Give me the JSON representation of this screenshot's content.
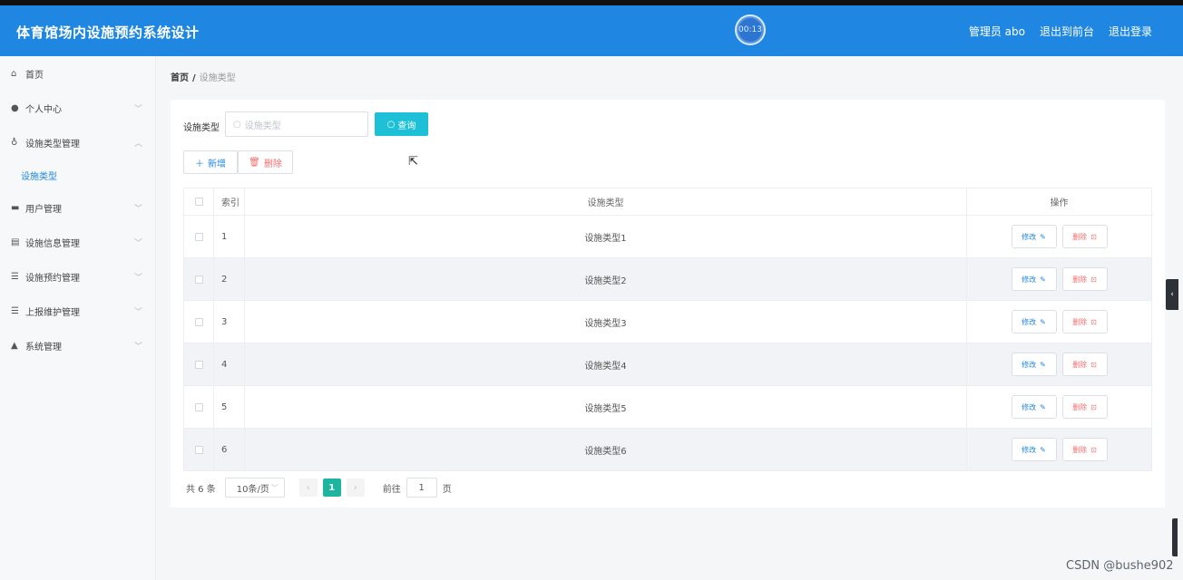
{
  "header": {
    "title": "体育馆场内设施预约系统设计",
    "timer": "00:13",
    "links": [
      "管理员 abo",
      "退出到前台",
      "退出登录"
    ]
  },
  "sidebar": {
    "items": [
      {
        "label": "首页",
        "icon": "home-icon"
      },
      {
        "label": "个人中心",
        "icon": "user-icon"
      },
      {
        "label": "设施类型管理",
        "icon": "mic-icon"
      },
      {
        "label": "用户管理",
        "icon": "users-icon"
      },
      {
        "label": "设施信息管理",
        "icon": "doc-icon"
      },
      {
        "label": "设施预约管理",
        "icon": "list-icon"
      },
      {
        "label": "上报维护管理",
        "icon": "list-icon"
      },
      {
        "label": "系统管理",
        "icon": "settings-icon"
      }
    ],
    "submenu": "设施类型"
  },
  "breadcrumb": {
    "home": "首页",
    "separator": "/",
    "current": "设施类型"
  },
  "search": {
    "label": "设施类型",
    "placeholder": "设施类型",
    "button": "查询"
  },
  "actions": {
    "add": "新增",
    "delete": "删除"
  },
  "table": {
    "headers": {
      "index": "索引",
      "type": "设施类型",
      "ops": "操作"
    },
    "rows": [
      {
        "index": "1",
        "type": "设施类型1"
      },
      {
        "index": "2",
        "type": "设施类型2"
      },
      {
        "index": "3",
        "type": "设施类型3"
      },
      {
        "index": "4",
        "type": "设施类型4"
      },
      {
        "index": "5",
        "type": "设施类型5"
      },
      {
        "index": "6",
        "type": "设施类型6"
      }
    ],
    "edit_label": "修改",
    "delete_label": "删除"
  },
  "pagination": {
    "total": "共 6 条",
    "page_size": "10条/页",
    "current_page": "1",
    "goto_label": "前往",
    "goto_value": "1",
    "page_unit": "页"
  },
  "watermark": "CSDN @bushe902",
  "colors": {
    "header": "#1f87e2",
    "query_button": "#1ec0d7",
    "active_page": "#1db5a0",
    "danger": "#f56c6c"
  }
}
